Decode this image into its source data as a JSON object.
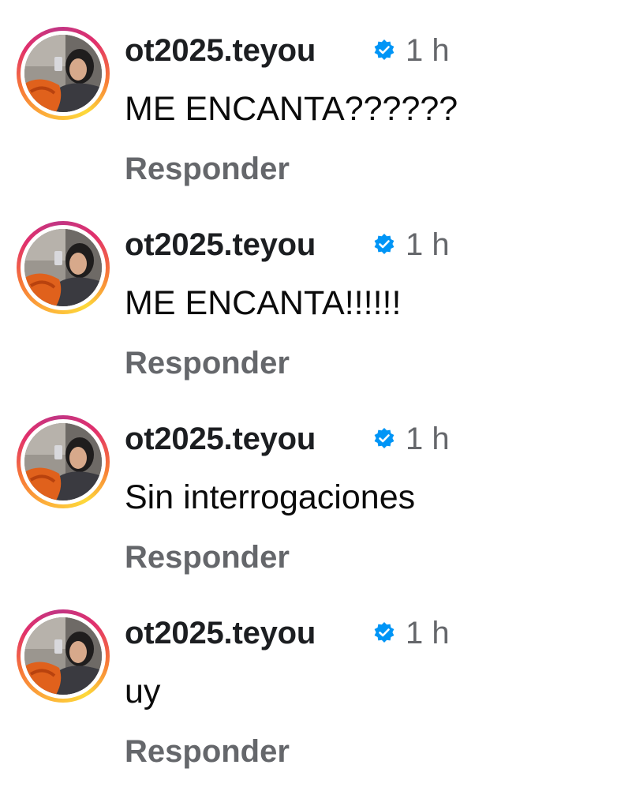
{
  "comments": [
    {
      "username": "ot2025.teyou",
      "time": "1 h",
      "text": "ME ENCANTA??????",
      "reply_label": "Responder"
    },
    {
      "username": "ot2025.teyou",
      "time": "1 h",
      "text": "ME ENCANTA!!!!!!",
      "reply_label": "Responder"
    },
    {
      "username": "ot2025.teyou",
      "time": "1 h",
      "text": "Sin interrogaciones",
      "reply_label": "Responder"
    },
    {
      "username": "ot2025.teyou",
      "time": "1 h",
      "text": "uy",
      "reply_label": "Responder"
    }
  ],
  "icons": {
    "verified": "verified-badge-icon",
    "avatar": "avatar"
  },
  "colors": {
    "verified_blue": "#0095f6",
    "muted_text": "#65676b",
    "story_ring_start": "#fdb23a",
    "story_ring_end": "#e1306c"
  }
}
